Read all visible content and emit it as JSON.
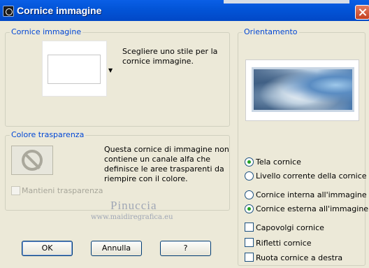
{
  "window": {
    "title": "Cornice immagine"
  },
  "frame_group": {
    "label": "Cornice immagine",
    "description": [
      "Scegliere uno stile per la",
      "cornice immagine."
    ]
  },
  "transparency_group": {
    "label": "Colore trasparenza",
    "description": [
      "Questa cornice di immagine non",
      "contiene un canale alfa che",
      "definisce le aree trasparenti da",
      "riempire con il colore."
    ],
    "keep_transparency": {
      "label": "Mantieni trasparenza",
      "checked": false,
      "enabled": false
    }
  },
  "orientation_group": {
    "label": "Orientamento",
    "options": {
      "tela_cornice": {
        "label": "Tela cornice",
        "checked": true
      },
      "livello_corrente": {
        "label": "Livello corrente della cornice",
        "checked": false
      },
      "cornice_interna": {
        "label": "Cornice interna all'immagine",
        "checked": false
      },
      "cornice_esterna": {
        "label": "Cornice esterna all'immagine",
        "checked": true
      },
      "capovolgi": {
        "label": "Capovolgi cornice",
        "checked": false
      },
      "rifletti": {
        "label": "Rifletti cornice",
        "checked": false
      },
      "ruota": {
        "label": "Ruota cornice a destra",
        "checked": false
      }
    }
  },
  "watermark": {
    "name": "Pinuccia",
    "url": "www.maidiregrafica.eu"
  },
  "buttons": {
    "ok": "OK",
    "cancel": "Annulla",
    "help": "?"
  },
  "colors": {
    "titlebar": "#0355d8",
    "group_label": "#0046d5",
    "radio_dot": "#21a121"
  }
}
